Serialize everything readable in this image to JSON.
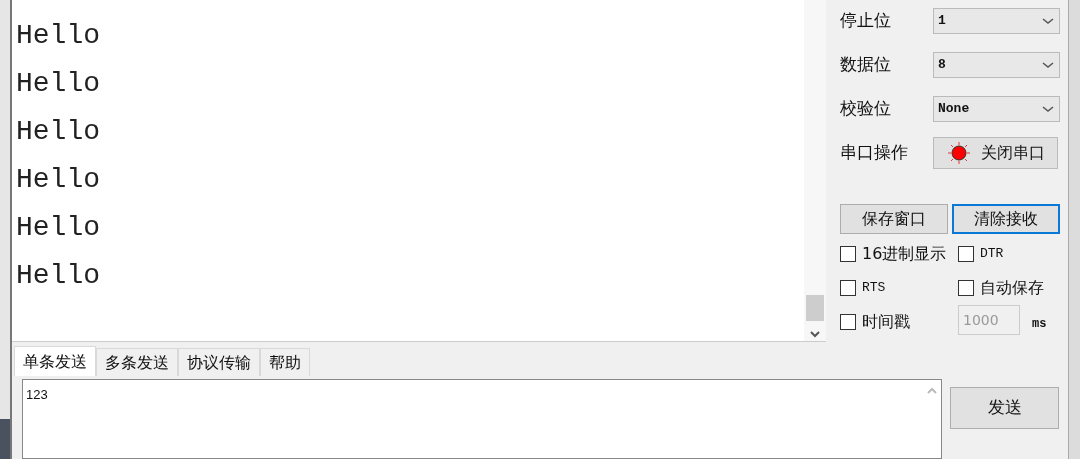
{
  "receive": {
    "lines": [
      "Hello",
      "Hello",
      "Hello",
      "Hello",
      "Hello",
      "Hello"
    ]
  },
  "settings": [
    {
      "kind": "select",
      "label": "停止位",
      "value": "1"
    },
    {
      "kind": "select",
      "label": "数据位",
      "value": "8"
    },
    {
      "kind": "select",
      "label": "校验位",
      "value": "None"
    },
    {
      "kind": "button",
      "label": "串口操作",
      "text": "关闭串口",
      "on": true
    }
  ],
  "action_buttons": [
    {
      "label": "保存窗口",
      "focused": false
    },
    {
      "label": "清除接收",
      "focused": true
    }
  ],
  "checkboxes": [
    {
      "label": "16进制显示",
      "checked": false
    },
    {
      "label": "DTR",
      "checked": false
    },
    {
      "label": "RTS",
      "checked": false
    },
    {
      "label": "自动保存",
      "checked": false
    },
    {
      "label": "时间戳",
      "checked": false
    }
  ],
  "interval": {
    "value": "1000",
    "unit": "ms",
    "disabled": true
  },
  "tabs": [
    {
      "label": "单条发送",
      "selected": true
    },
    {
      "label": "多条发送",
      "selected": false
    },
    {
      "label": "协议传输",
      "selected": false
    },
    {
      "label": "帮助",
      "selected": false
    }
  ],
  "send": {
    "value": "123",
    "button": "发送"
  }
}
